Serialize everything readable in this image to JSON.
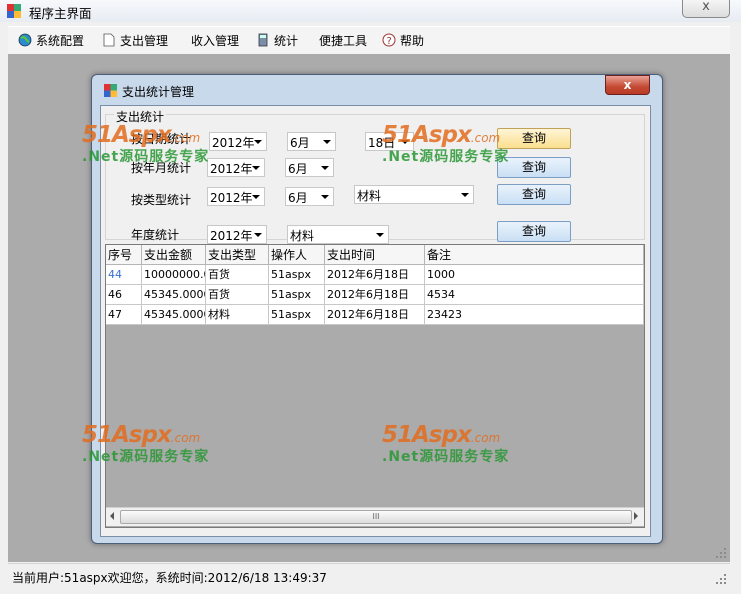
{
  "main_window": {
    "title": "程序主界面",
    "close_glyph": "x"
  },
  "menu": [
    {
      "label": "系统配置",
      "icon": "globe-icon"
    },
    {
      "label": "支出管理",
      "icon": "document-icon"
    },
    {
      "label": "收入管理",
      "icon": ""
    },
    {
      "label": "统计",
      "icon": "calculator-icon"
    },
    {
      "label": "便捷工具",
      "icon": ""
    },
    {
      "label": "帮助",
      "icon": "help-icon"
    }
  ],
  "child_window": {
    "title": "支出统计管理",
    "close_glyph": "x"
  },
  "group": {
    "title": "支出统计",
    "rows": [
      {
        "label": "按日期统计",
        "year": "2012年",
        "month": "6月",
        "day": "18日",
        "button": "查询"
      },
      {
        "label": "按年月统计",
        "year": "2012年",
        "month": "6月",
        "button": "查询"
      },
      {
        "label": "按类型统计",
        "year": "2012年",
        "month": "6月",
        "type": "材料",
        "button": "查询"
      },
      {
        "label": "年度统计",
        "year": "2012年",
        "type": "材料",
        "button": "查询"
      }
    ]
  },
  "grid": {
    "columns": [
      "序号",
      "支出金额",
      "支出类型",
      "操作人",
      "支出时间",
      "备注"
    ],
    "rows": [
      [
        "44",
        "10000000.0",
        "百货",
        "51aspx",
        "2012年6月18日",
        "1000"
      ],
      [
        "46",
        "45345.0000",
        "百货",
        "51aspx",
        "2012年6月18日",
        "4534"
      ],
      [
        "47",
        "45345.0000",
        "材料",
        "51aspx",
        "2012年6月18日",
        "23423"
      ]
    ],
    "scroll_thumb": "III"
  },
  "status": {
    "text": "当前用户:51aspx欢迎您，系统时间:2012/6/18 13:49:37"
  },
  "watermark": {
    "brand": "51Aspx",
    "domain": ".com",
    "tagline": ".Net源码服务专家"
  }
}
